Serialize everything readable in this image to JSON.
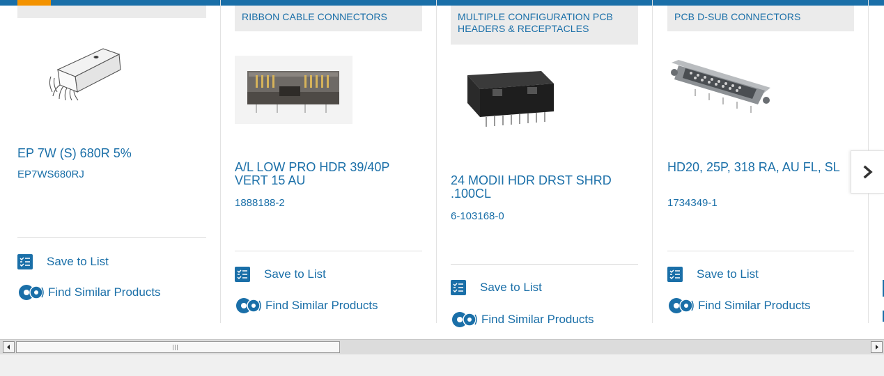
{
  "products": [
    {
      "category": "",
      "title": "EP 7W (S) 680R 5%",
      "part_number": "EP7WS680RJ",
      "save_label": "Save to List",
      "similar_label": "Find Similar Products",
      "image_icon": "resistor-network-drawing"
    },
    {
      "category": "RIBBON CABLE CONNECTORS",
      "title": "A/L LOW PRO HDR 39/40P VERT 15 AU",
      "part_number": "1888188-2",
      "save_label": "Save to List",
      "similar_label": "Find Similar Products",
      "image_icon": "box-header-connector-photo"
    },
    {
      "category": "MULTIPLE CONFIGURATION PCB HEADERS & RECEPTACLES",
      "title": "24 MODII HDR DRST SHRD .100CL",
      "part_number": "6-103168-0",
      "save_label": "Save to List",
      "similar_label": "Find Similar Products",
      "image_icon": "shrouded-header-photo"
    },
    {
      "category": "PCB D-SUB CONNECTORS",
      "title": "HD20, 25P, 318 RA, AU FL, SL",
      "part_number": "1734349-1",
      "save_label": "Save to List",
      "similar_label": "Find Similar Products",
      "image_icon": "d-sub-connector-photo"
    }
  ],
  "carousel": {
    "next_icon": "chevron-right-icon"
  },
  "colors": {
    "brand_blue": "#1a6fa8",
    "accent_orange": "#f39200",
    "banner_gray": "#ebebeb"
  }
}
